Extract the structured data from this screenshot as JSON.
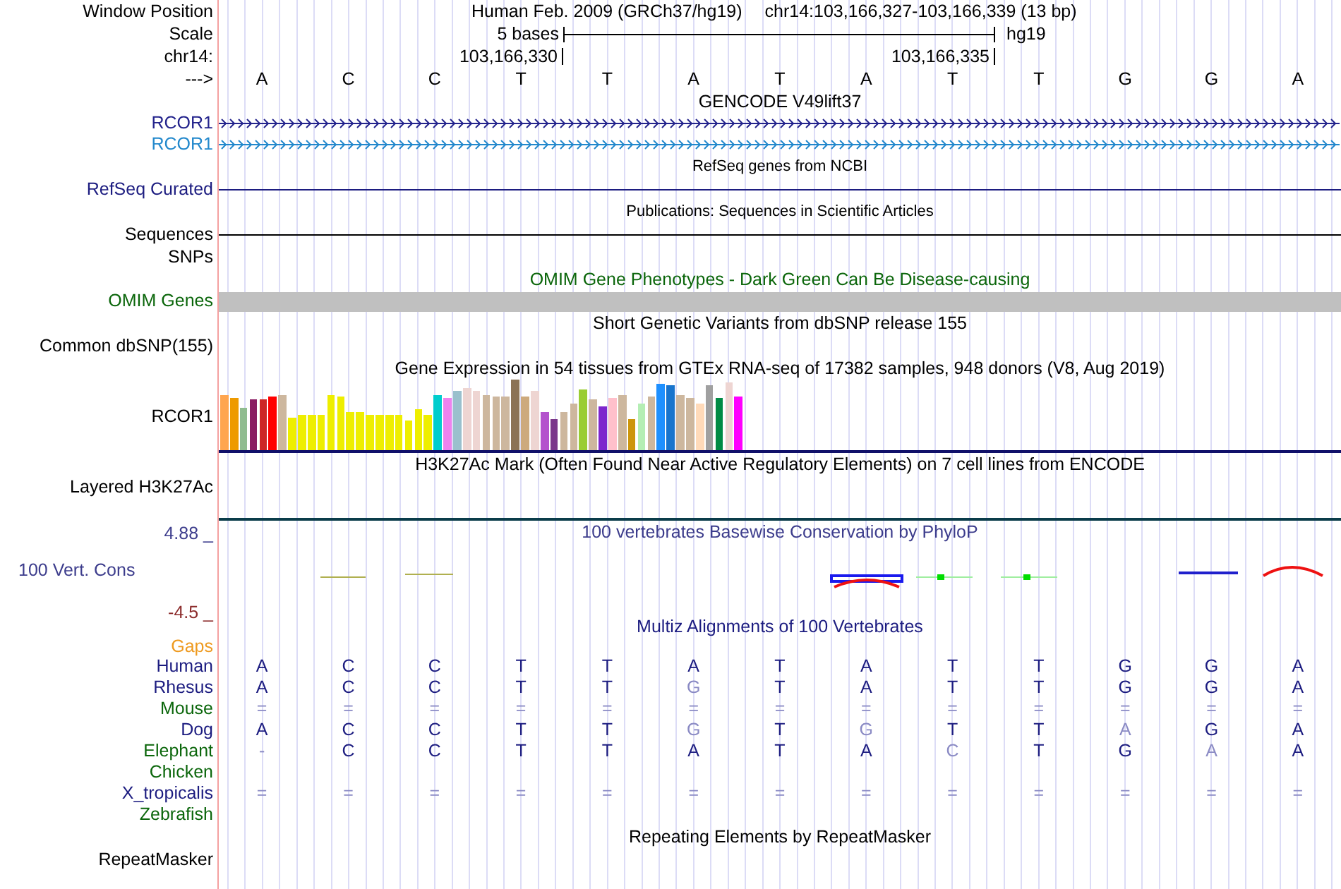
{
  "header": {
    "position_label": "Window Position",
    "assembly": "Human Feb. 2009 (GRCh37/hg19)",
    "position": "chr14:103,166,327-103,166,339 (13 bp)",
    "scale_label": "Scale",
    "scale_text": "5 bases",
    "scale_assembly": "hg19",
    "chrom_label": "chr14:",
    "coord_start": "103,166,330",
    "coord_end": "103,166,335",
    "strand_label": "--->",
    "bases": [
      "A",
      "C",
      "C",
      "T",
      "T",
      "A",
      "T",
      "A",
      "T",
      "T",
      "G",
      "G",
      "A"
    ]
  },
  "tracks": [
    {
      "kind": "gene",
      "title": "GENCODE V49lift37",
      "rows": [
        {
          "label": "RCOR1",
          "color": "#23238c"
        },
        {
          "label": "RCOR1",
          "color": "#2288cc"
        }
      ]
    },
    {
      "kind": "line",
      "title": "RefSeq genes from NCBI",
      "label": "RefSeq Curated",
      "color": "#1c1c80"
    },
    {
      "kind": "line",
      "title": "Publications: Sequences in Scientific Articles",
      "label": "Sequences",
      "color": "#000000"
    },
    {
      "kind": "label",
      "label": "SNPs",
      "color": "#000000"
    },
    {
      "kind": "bar",
      "title": "OMIM Gene Phenotypes - Dark Green Can Be Disease-causing",
      "label": "OMIM Genes",
      "color": "#0b660b"
    },
    {
      "kind": "label",
      "title": "Short Genetic Variants from dbSNP release 155",
      "label": "Common dbSNP(155)",
      "color": "#000000"
    },
    {
      "kind": "expression",
      "title": "Gene Expression in 54 tissues from GTEx RNA-seq of 17382 samples, 948 donors (V8, Aug 2019)",
      "label": "RCOR1",
      "color": "#000000"
    },
    {
      "kind": "label",
      "title": "H3K27Ac Mark (Often Found Near Active Regulatory Elements) on 7 cell lines from ENCODE",
      "label": "Layered H3K27Ac",
      "color": "#000000"
    },
    {
      "kind": "wiggle",
      "title": "100 vertebrates Basewise Conservation by PhyloP",
      "label": "100 Vert. Cons",
      "color": "#3c3c8c",
      "max": "4.88 _",
      "min": "-4.5 _"
    },
    {
      "kind": "alignment",
      "title": "Multiz Alignments of 100 Vertebrates",
      "color": "#1c1c80",
      "gaps": {
        "label": "Gaps",
        "color": "#ee9a20"
      },
      "species": [
        {
          "name": "Human",
          "color": "#1c1c80",
          "bases": [
            {
              "base": "A",
              "faded": false
            },
            {
              "base": "C",
              "faded": false
            },
            {
              "base": "C",
              "faded": false
            },
            {
              "base": "T",
              "faded": false
            },
            {
              "base": "T",
              "faded": false
            },
            {
              "base": "A",
              "faded": false
            },
            {
              "base": "T",
              "faded": false
            },
            {
              "base": "A",
              "faded": false
            },
            {
              "base": "T",
              "faded": false
            },
            {
              "base": "T",
              "faded": false
            },
            {
              "base": "G",
              "faded": false
            },
            {
              "base": "G",
              "faded": false
            },
            {
              "base": "A",
              "faded": false
            }
          ]
        },
        {
          "name": "Rhesus",
          "color": "#1c1c80",
          "bases": [
            {
              "base": "A",
              "faded": false
            },
            {
              "base": "C",
              "faded": false
            },
            {
              "base": "C",
              "faded": false
            },
            {
              "base": "T",
              "faded": false
            },
            {
              "base": "T",
              "faded": false
            },
            {
              "base": "G",
              "faded": true
            },
            {
              "base": "T",
              "faded": false
            },
            {
              "base": "A",
              "faded": false
            },
            {
              "base": "T",
              "faded": false
            },
            {
              "base": "T",
              "faded": false
            },
            {
              "base": "G",
              "faded": false
            },
            {
              "base": "G",
              "faded": false
            },
            {
              "base": "A",
              "faded": false
            }
          ]
        },
        {
          "name": "Mouse",
          "color": "#0b660b",
          "bases": [
            {
              "base": "=",
              "faded": true
            },
            {
              "base": "=",
              "faded": true
            },
            {
              "base": "=",
              "faded": true
            },
            {
              "base": "=",
              "faded": true
            },
            {
              "base": "=",
              "faded": true
            },
            {
              "base": "=",
              "faded": true
            },
            {
              "base": "=",
              "faded": true
            },
            {
              "base": "=",
              "faded": true
            },
            {
              "base": "=",
              "faded": true
            },
            {
              "base": "=",
              "faded": true
            },
            {
              "base": "=",
              "faded": true
            },
            {
              "base": "=",
              "faded": true
            },
            {
              "base": "=",
              "faded": true
            }
          ]
        },
        {
          "name": "Dog",
          "color": "#1c1c80",
          "bases": [
            {
              "base": "A",
              "faded": false
            },
            {
              "base": "C",
              "faded": false
            },
            {
              "base": "C",
              "faded": false
            },
            {
              "base": "T",
              "faded": false
            },
            {
              "base": "T",
              "faded": false
            },
            {
              "base": "G",
              "faded": true
            },
            {
              "base": "T",
              "faded": false
            },
            {
              "base": "G",
              "faded": true
            },
            {
              "base": "T",
              "faded": false
            },
            {
              "base": "T",
              "faded": false
            },
            {
              "base": "A",
              "faded": true
            },
            {
              "base": "G",
              "faded": false
            },
            {
              "base": "A",
              "faded": false
            }
          ]
        },
        {
          "name": "Elephant",
          "color": "#0b660b",
          "bases": [
            {
              "base": "-",
              "faded": true
            },
            {
              "base": "C",
              "faded": false
            },
            {
              "base": "C",
              "faded": false
            },
            {
              "base": "T",
              "faded": false
            },
            {
              "base": "T",
              "faded": false
            },
            {
              "base": "A",
              "faded": false
            },
            {
              "base": "T",
              "faded": false
            },
            {
              "base": "A",
              "faded": false
            },
            {
              "base": "C",
              "faded": true
            },
            {
              "base": "T",
              "faded": false
            },
            {
              "base": "G",
              "faded": false
            },
            {
              "base": "A",
              "faded": true
            },
            {
              "base": "A",
              "faded": false
            }
          ]
        },
        {
          "name": "Chicken",
          "color": "#0b660b"
        },
        {
          "name": "X_tropicalis",
          "color": "#1c1c80",
          "bases": [
            {
              "base": "=",
              "faded": true
            },
            {
              "base": "=",
              "faded": true
            },
            {
              "base": "=",
              "faded": true
            },
            {
              "base": "=",
              "faded": true
            },
            {
              "base": "=",
              "faded": true
            },
            {
              "base": "=",
              "faded": true
            },
            {
              "base": "=",
              "faded": true
            },
            {
              "base": "=",
              "faded": true
            },
            {
              "base": "=",
              "faded": true
            },
            {
              "base": "=",
              "faded": true
            },
            {
              "base": "=",
              "faded": true
            },
            {
              "base": "=",
              "faded": true
            },
            {
              "base": "=",
              "faded": true
            }
          ]
        },
        {
          "name": "Zebrafish",
          "color": "#0b660b"
        }
      ]
    },
    {
      "kind": "label",
      "title": "Repeating Elements by RepeatMasker",
      "label": "RepeatMasker",
      "color": "#000000"
    }
  ]
}
